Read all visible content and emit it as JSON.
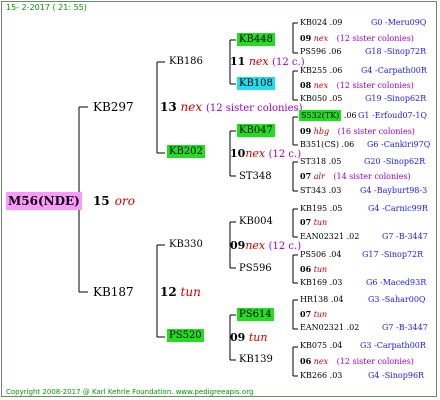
{
  "header": "15-  2-2017 ( 21: 55)",
  "footer": "Copyright 2008-2017 @ Karl Kehrle Foundation.   www.pedigreeapis.org",
  "root": {
    "name": "M56(NDE)",
    "num": "15",
    "race": "oro"
  },
  "gen1": [
    {
      "name": "KB297",
      "num": "13",
      "race": "nex",
      "extra": "(12 sister colonies)"
    },
    {
      "name": "KB187",
      "num": "12",
      "race": "tun",
      "extra": ""
    }
  ],
  "gen2": [
    {
      "name": "KB186",
      "num": "11",
      "race": "nex",
      "extra": "(12 c.)"
    },
    {
      "name": "KB202",
      "num": "10",
      "race": "nex",
      "extra": "(12 c.)"
    },
    {
      "name": "KB330",
      "num": "09",
      "race": "nex",
      "extra": "(12 c.)"
    },
    {
      "name": "PS520",
      "num": "09",
      "race": "tun",
      "extra": ""
    }
  ],
  "gen3": [
    {
      "name": "KB448"
    },
    {
      "name": "KB108"
    },
    {
      "name": "KB047"
    },
    {
      "name": "ST348"
    },
    {
      "name": "KB004"
    },
    {
      "name": "PS596"
    },
    {
      "name": "PS614"
    },
    {
      "name": "KB139"
    }
  ],
  "gen4": [
    {
      "top": {
        "id": "KB024",
        "yr": ".09",
        "loc": "G0 -Meru09Q"
      },
      "num": "09",
      "race": "nex",
      "extra": "(12 sister colonies)",
      "bot": {
        "id": "PS596",
        "yr": ".06",
        "loc": "G18 -Sinop72R"
      }
    },
    {
      "top": {
        "id": "KB255",
        "yr": ".06",
        "loc": "G4 -Carpath00R"
      },
      "num": "08",
      "race": "nex",
      "extra": "(12 sister colonies)",
      "bot": {
        "id": "KB050",
        "yr": ".05",
        "loc": "G19 -Sinop62R"
      }
    },
    {
      "top": {
        "id": "S532(TK)",
        "yr": ".06",
        "loc": "G1 -Erfoud07-1Q"
      },
      "num": "09",
      "race": "hbg",
      "extra": "(16 sister colonies)",
      "bot": {
        "id": "B351(CS)",
        "yr": ".06",
        "loc": "G6 -Cankiri97Q"
      }
    },
    {
      "top": {
        "id": "ST318",
        "yr": ".05",
        "loc": "G20 -Sinop62R"
      },
      "num": "07",
      "race": "alr",
      "extra": "(14 sister colonies)",
      "bot": {
        "id": "ST343",
        "yr": ".03",
        "loc": "G4 -Bayburt98-3"
      }
    },
    {
      "top": {
        "id": "KB195",
        "yr": ".05",
        "loc": "G4 -Carnic99R"
      },
      "num": "07",
      "race": "tun",
      "extra": "",
      "bot": {
        "id": "EAN02321",
        "yr": ".02",
        "loc": "G7 -B-3447"
      }
    },
    {
      "top": {
        "id": "PS506",
        "yr": ".04",
        "loc": "G17 -Sinop72R"
      },
      "num": "06",
      "race": "tun",
      "extra": "",
      "bot": {
        "id": "KB169",
        "yr": ".03",
        "loc": "G6 -Maced93R"
      }
    },
    {
      "top": {
        "id": "HR138",
        "yr": ".04",
        "loc": "G3 -Sahar00Q"
      },
      "num": "07",
      "race": "tun",
      "extra": "",
      "bot": {
        "id": "EAN02321",
        "yr": ".02",
        "loc": "G7 -B-3447"
      }
    },
    {
      "top": {
        "id": "KB075",
        "yr": ".04",
        "loc": "G3 -Carpath00R"
      },
      "num": "06",
      "race": "nex",
      "extra": "(12 sister colonies)",
      "bot": {
        "id": "KB266",
        "yr": ".03",
        "loc": "G4 -Sinop96R"
      }
    }
  ],
  "colors": {
    "frame": "#6a8a6a",
    "header": "#009900",
    "loc": "#1a1aff",
    "race": "#cc0000",
    "sisters": "#9900cc",
    "highlight_green": "#22dd22",
    "highlight_cyan": "#22ddee",
    "root_bg": "#ff99ff"
  }
}
